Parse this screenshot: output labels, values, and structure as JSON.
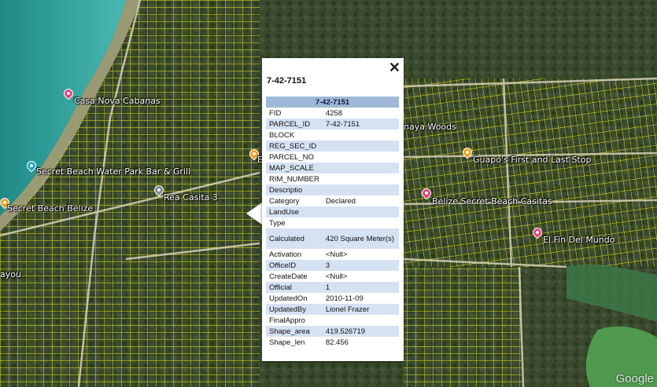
{
  "map": {
    "pins": [
      {
        "label": "Casa Nova Cabanas",
        "color": "#e0457b"
      },
      {
        "label": "Secret Beach Water Park Bar & Grill",
        "color": "#1ea6c8"
      },
      {
        "label": "Secret Beach Belize",
        "color": "#f0a020"
      },
      {
        "label": "Rea Casita 3",
        "color": "#7a8a9a"
      },
      {
        "label": "Guapo's First and Last Stop",
        "color": "#f0a020"
      },
      {
        "label": "Belize Secret Beach Casitas",
        "color": "#e0457b"
      },
      {
        "label": "El Fin Del Mundo",
        "color": "#e0457b"
      },
      {
        "label": "",
        "color": "#f0a020"
      }
    ],
    "place_labels": {
      "maya_woods": "naya Woods",
      "bayou": "ayou",
      "partial_e": "E"
    },
    "attribution": "Google"
  },
  "popup": {
    "close_label": "✕",
    "title": "7-42-7151",
    "header": "7-42-7151",
    "rows": [
      {
        "key": "FID",
        "value": "4258"
      },
      {
        "key": "PARCEL_ID",
        "value": "7-42-7151"
      },
      {
        "key": "BLOCK",
        "value": ""
      },
      {
        "key": "REG_SEC_ID",
        "value": ""
      },
      {
        "key": "PARCEL_NO",
        "value": ""
      },
      {
        "key": "MAP_SCALE",
        "value": ""
      },
      {
        "key": "RIM_NUMBER",
        "value": ""
      },
      {
        "key": "Descriptio",
        "value": ""
      },
      {
        "key": "Category",
        "value": "Declared"
      },
      {
        "key": "LandUse",
        "value": ""
      },
      {
        "key": "Type",
        "value": ""
      },
      {
        "key": "Calculated",
        "value": "420 Square Meter(s)"
      },
      {
        "key": "Activation",
        "value": "<Null>"
      },
      {
        "key": "OfficeID",
        "value": "3"
      },
      {
        "key": "CreateDate",
        "value": "<Null>"
      },
      {
        "key": "Official",
        "value": "1"
      },
      {
        "key": "UpdatedOn",
        "value": "2010-11-09"
      },
      {
        "key": "UpdatedBy",
        "value": "Lionel Frazer"
      },
      {
        "key": "FinalAppro",
        "value": ""
      },
      {
        "key": "Shape_area",
        "value": "419.526719"
      },
      {
        "key": "Shape_len",
        "value": "82.456"
      }
    ]
  }
}
